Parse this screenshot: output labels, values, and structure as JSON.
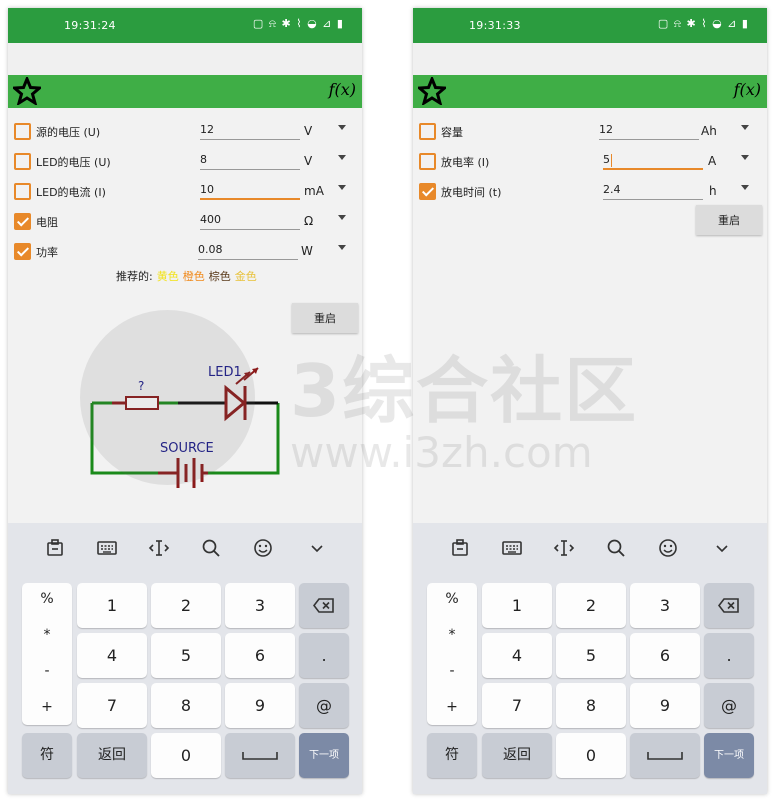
{
  "colors": {
    "statusbar": "#2b9c3f",
    "toolbar": "#3fae46",
    "accent": "#e8892a",
    "keyboard": "#e3e5ea",
    "enter_key": "#7c8aa6"
  },
  "left": {
    "status_time": "19:31:24",
    "status_icons": "▢ ⍾ ✱ ⌇ ◒ ⊿ ▮",
    "toolbar_fx": "f(x)",
    "rows": [
      {
        "label": "源的电压 (U)",
        "value": "12",
        "unit": "V",
        "checked": false
      },
      {
        "label": "LED的电压 (U)",
        "value": "8",
        "unit": "V",
        "checked": false
      },
      {
        "label": "LED的电流 (I)",
        "value": "10",
        "unit": "mA",
        "checked": false
      },
      {
        "label": "电阻",
        "value": "400",
        "unit": "Ω",
        "checked": true
      },
      {
        "label": "功率",
        "value": "0.08",
        "unit": "W",
        "checked": true
      }
    ],
    "recommend": {
      "prefix": "推荐的:",
      "colors": [
        {
          "name": "黄色",
          "color": "#f2e21a"
        },
        {
          "name": "橙色",
          "color": "#f08a1c"
        },
        {
          "name": "棕色",
          "color": "#5a3a1a"
        },
        {
          "name": "金色",
          "color": "#e8c23a"
        }
      ]
    },
    "reset_label": "重启",
    "circuit": {
      "resistor_label": "?",
      "led_label": "LED1",
      "source_label": "SOURCE"
    }
  },
  "right": {
    "status_time": "19:31:33",
    "status_icons": "▢ ⍾ ✱ ⌇ ◒ ⊿ ▮",
    "toolbar_fx": "f(x)",
    "rows": [
      {
        "label": "容量",
        "value": "12",
        "unit": "Ah",
        "checked": false
      },
      {
        "label": "放电率 (I)",
        "value": "5",
        "unit": "A",
        "checked": false
      },
      {
        "label": "放电时间 (t)",
        "value": "2.4",
        "unit": "h",
        "checked": true
      }
    ],
    "reset_label": "重启"
  },
  "keyboard": {
    "tools": [
      "clipboard-icon",
      "keyboard-icon",
      "cursor-move-icon",
      "search-icon",
      "emoji-icon",
      "chevron-down-icon"
    ],
    "symbols": [
      "%",
      "*",
      "-",
      "+"
    ],
    "digits": [
      "1",
      "2",
      "3",
      "4",
      "5",
      "6",
      "7",
      "8",
      "9",
      "0"
    ],
    "dot": ".",
    "at": "@",
    "sym_label": "符",
    "back_label": "返回",
    "enter_label": "下一项"
  },
  "watermark": {
    "cn": "3综合社区",
    "en": "www.i3zh.com"
  }
}
